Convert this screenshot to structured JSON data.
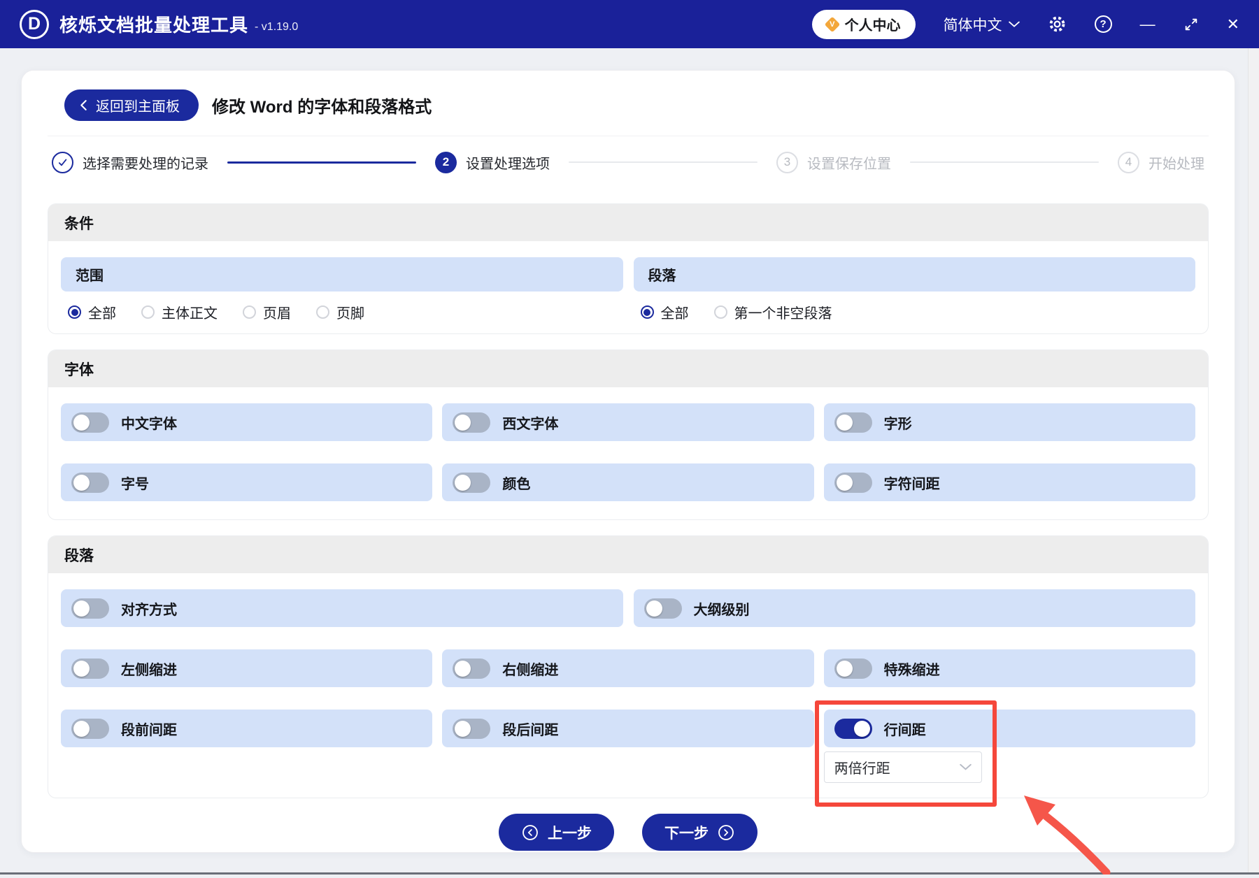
{
  "colors": {
    "accent": "#1b2a9e",
    "titlebar_bg": "#1a2199",
    "row_blue": "#d3e1f9",
    "annotation_red": "#f5473b"
  },
  "titlebar": {
    "logo_letter": "D",
    "app_title": "核烁文档批量处理工具",
    "version": "- v1.19.0",
    "personal_center_label": "个人中心",
    "vip_letter": "V",
    "language_label": "简体中文",
    "help_glyph": "?",
    "minimize_glyph": "—",
    "close_glyph": "✕"
  },
  "header": {
    "back_label": "返回到主面板",
    "page_title": "修改 Word 的字体和段落格式"
  },
  "stepper": [
    {
      "state": "done",
      "label": "选择需要处理的记录"
    },
    {
      "state": "active",
      "num": "2",
      "label": "设置处理选项"
    },
    {
      "state": "pending",
      "num": "3",
      "label": "设置保存位置"
    },
    {
      "state": "pending",
      "num": "4",
      "label": "开始处理"
    }
  ],
  "condition_section": {
    "title": "条件",
    "groups": [
      {
        "title": "范围",
        "options": [
          {
            "label": "全部",
            "selected": true
          },
          {
            "label": "主体正文",
            "selected": false
          },
          {
            "label": "页眉",
            "selected": false
          },
          {
            "label": "页脚",
            "selected": false
          }
        ]
      },
      {
        "title": "段落",
        "options": [
          {
            "label": "全部",
            "selected": true
          },
          {
            "label": "第一个非空段落",
            "selected": false
          }
        ]
      }
    ]
  },
  "font_section": {
    "title": "字体",
    "toggles": [
      {
        "label": "中文字体",
        "on": false
      },
      {
        "label": "西文字体",
        "on": false
      },
      {
        "label": "字形",
        "on": false
      },
      {
        "label": "字号",
        "on": false
      },
      {
        "label": "颜色",
        "on": false
      },
      {
        "label": "字符间距",
        "on": false
      }
    ]
  },
  "paragraph_section": {
    "title": "段落",
    "row1": [
      {
        "label": "对齐方式",
        "on": false
      },
      {
        "label": "大纲级别",
        "on": false
      }
    ],
    "row2": [
      {
        "label": "左侧缩进",
        "on": false
      },
      {
        "label": "右侧缩进",
        "on": false
      },
      {
        "label": "特殊缩进",
        "on": false
      }
    ],
    "row3": [
      {
        "label": "段前间距",
        "on": false
      },
      {
        "label": "段后间距",
        "on": false
      },
      {
        "label": "行间距",
        "on": true
      }
    ],
    "line_spacing_select": {
      "value": "两倍行距"
    }
  },
  "footer": {
    "prev_label": "上一步",
    "next_label": "下一步"
  }
}
